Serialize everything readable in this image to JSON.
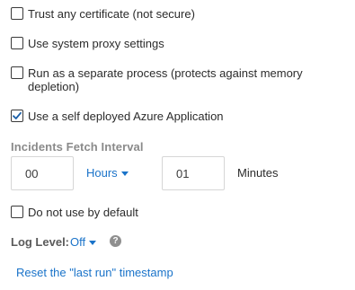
{
  "checkboxes": {
    "trust_cert": {
      "label": "Trust any certificate (not secure)",
      "checked": false
    },
    "system_proxy": {
      "label": "Use system proxy settings",
      "checked": false
    },
    "separate_process": {
      "label": "Run as a separate process (protects against memory depletion)",
      "checked": false
    },
    "azure_app": {
      "label": "Use a self deployed Azure Application",
      "checked": true
    },
    "not_default": {
      "label": "Do not use by default",
      "checked": false
    }
  },
  "fetch_interval": {
    "label": "Incidents Fetch Interval",
    "hours_value": "00",
    "hours_unit": "Hours",
    "minutes_value": "01",
    "minutes_unit": "Minutes"
  },
  "log_level": {
    "label": "Log Level:",
    "value": "Off"
  },
  "reset_link": "Reset the \"last run\" timestamp",
  "colors": {
    "link": "#1a73c9",
    "checkbox_border": "#3a3a3a",
    "section_label": "#8a8a8a"
  }
}
